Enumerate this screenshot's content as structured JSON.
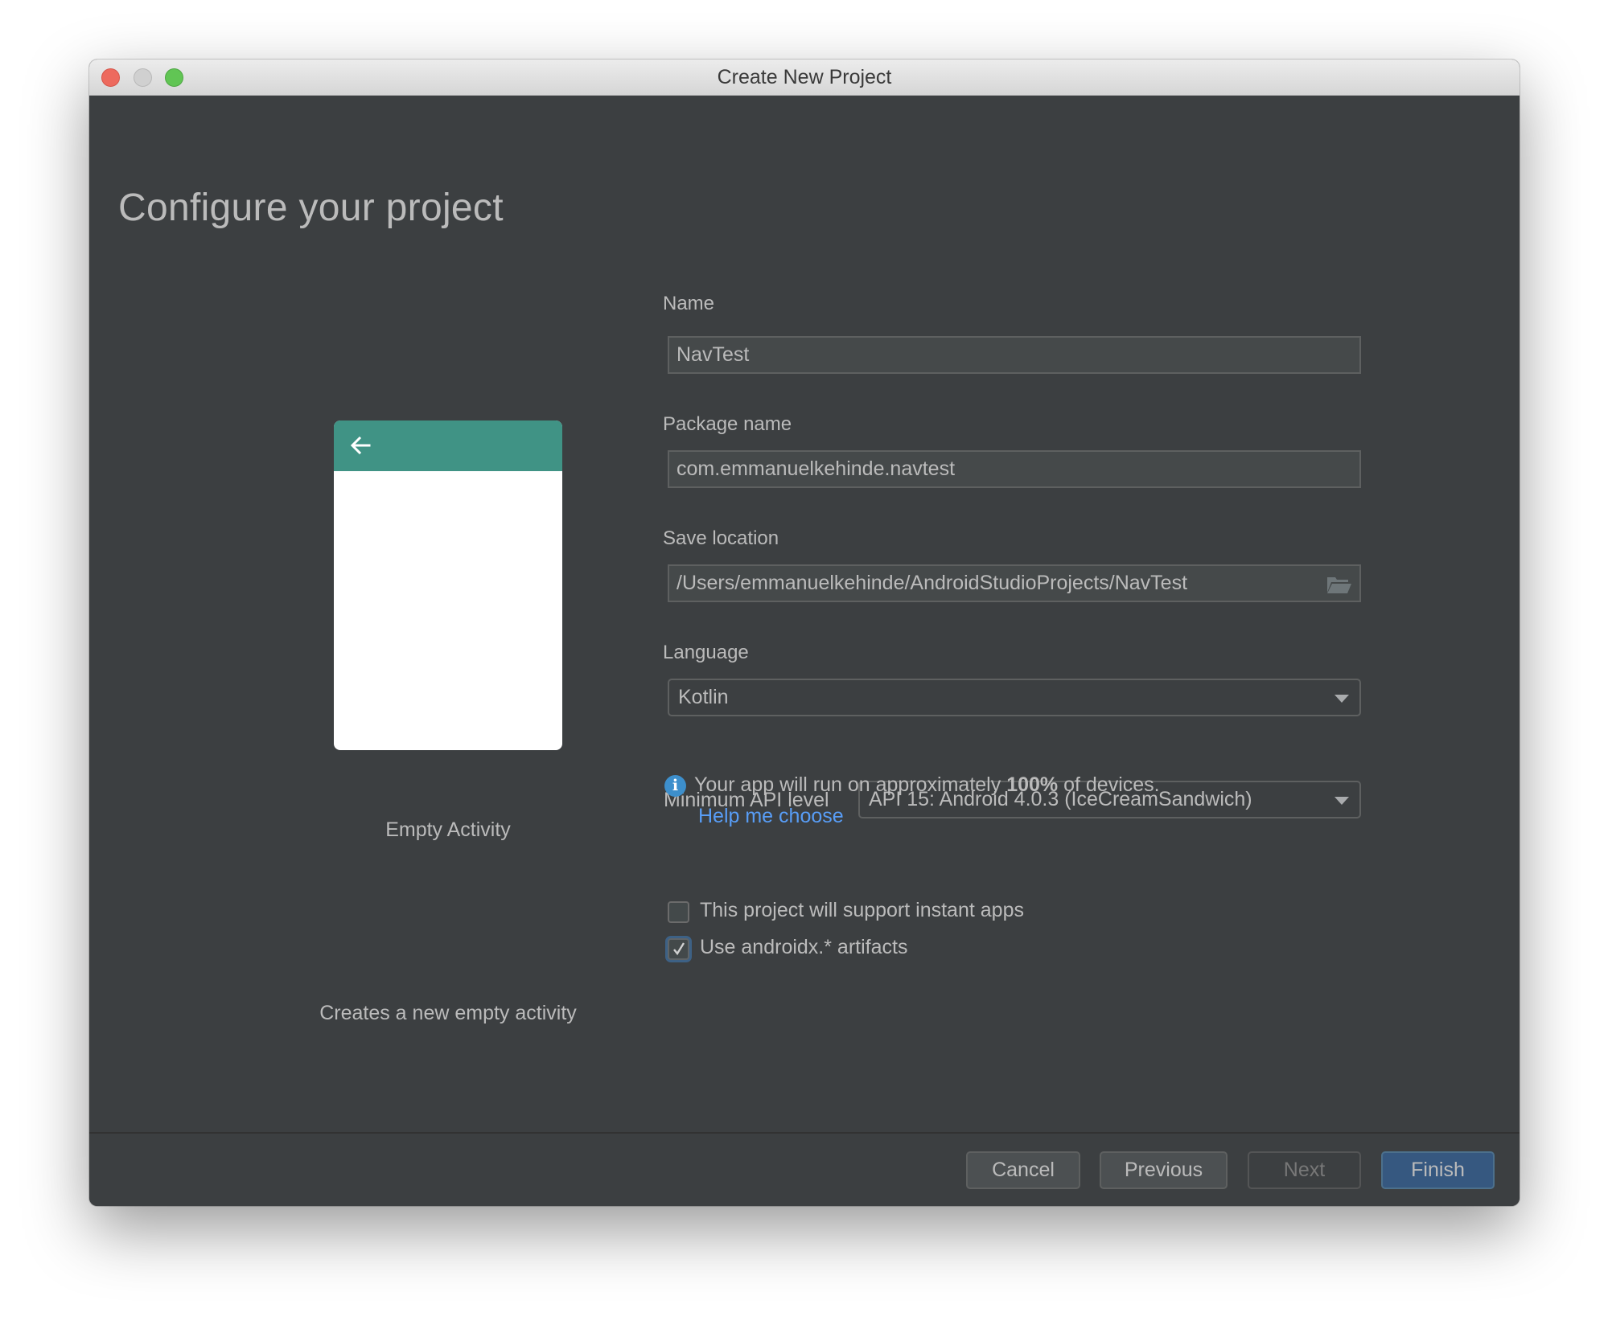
{
  "window": {
    "title": "Create New Project",
    "controls": [
      "close",
      "minimize",
      "zoom"
    ]
  },
  "page": {
    "heading": "Configure your project"
  },
  "template": {
    "name": "Empty Activity",
    "description": "Creates a new empty activity",
    "toolbar_color": "#409385",
    "back_icon": "arrow-left-icon"
  },
  "form": {
    "name": {
      "label": "Name",
      "value": "NavTest"
    },
    "package": {
      "label": "Package name",
      "value": "com.emmanuelkehinde.navtest"
    },
    "save_location": {
      "label": "Save location",
      "value": "/Users/emmanuelkehinde/AndroidStudioProjects/NavTest",
      "icon": "folder-open-icon"
    },
    "language": {
      "label": "Language",
      "value": "Kotlin"
    },
    "min_api": {
      "label": "Minimum API level",
      "value": "API 15: Android 4.0.3 (IceCreamSandwich)"
    },
    "info": {
      "prefix": "Your app will run on approximately ",
      "percent": "100%",
      "suffix": " of devices.",
      "icon": "info-icon"
    },
    "help_link": "Help me choose",
    "instant_apps": {
      "label": "This project will support instant apps",
      "checked": false
    },
    "androidx": {
      "label": "Use androidx.* artifacts",
      "checked": true
    }
  },
  "footer": {
    "cancel": "Cancel",
    "previous": "Previous",
    "next": "Next",
    "finish": "Finish"
  },
  "colors": {
    "background": "#3c3f41",
    "text": "#bbbbbb",
    "link": "#589df6",
    "primary_button": "#365880"
  }
}
